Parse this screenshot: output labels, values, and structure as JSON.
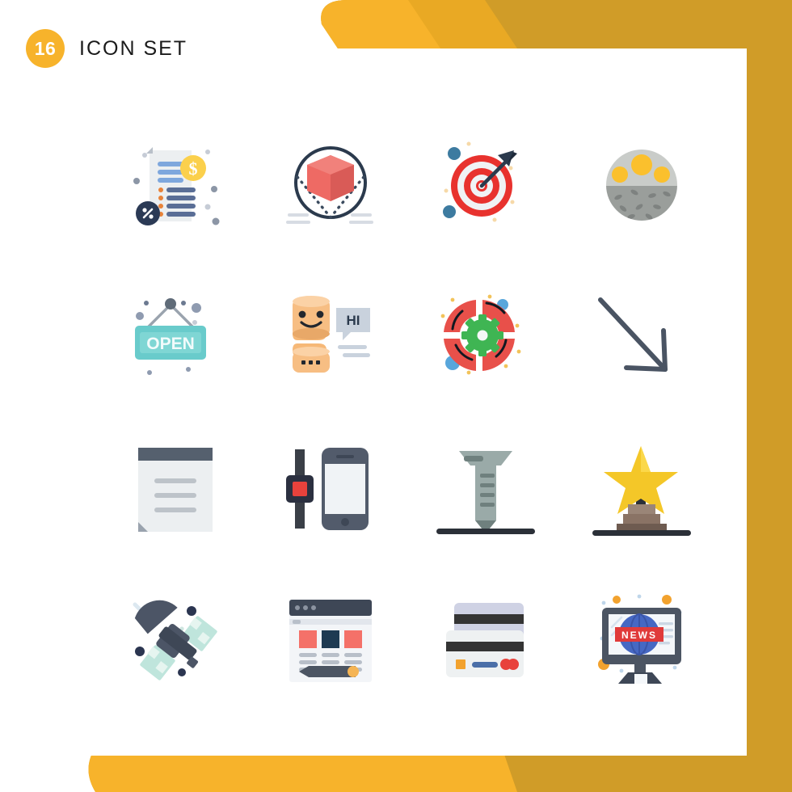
{
  "header": {
    "count": "16",
    "title": "Icon Set"
  },
  "theme": {
    "banner_light": "#F7B32B",
    "banner_mid": "#E9A924",
    "banner_dark": "#D09C28",
    "card_bg": "#FFFFFF",
    "title_color": "#1A1A1A",
    "badge_bg": "#F7B32B",
    "badge_text": "#FFFFFF"
  },
  "grid": {
    "columns": 4,
    "rows": 4,
    "icons": [
      {
        "id": 1,
        "name": "financial-document-icon",
        "label": "Financial document with dollar and percent badges"
      },
      {
        "id": 2,
        "name": "3d-cube-icon",
        "label": "3D cube in circle"
      },
      {
        "id": 3,
        "name": "target-arrow-icon",
        "label": "Target with arrow"
      },
      {
        "id": 4,
        "name": "frying-eggs-icon",
        "label": "Pan with fried eggs"
      },
      {
        "id": 5,
        "name": "open-sign-icon",
        "label": "Open hanging sign",
        "text": "OPEN"
      },
      {
        "id": 6,
        "name": "chatbot-icon",
        "label": "Chat robot with greeting bubble",
        "text": "HI"
      },
      {
        "id": 7,
        "name": "settings-target-icon",
        "label": "Crosshair with gear"
      },
      {
        "id": 8,
        "name": "diagonal-arrow-icon",
        "label": "Arrow pointing down right"
      },
      {
        "id": 9,
        "name": "document-note-icon",
        "label": "Note document with header bar"
      },
      {
        "id": 10,
        "name": "smartwatch-phone-icon",
        "label": "Smartwatch and smartphone"
      },
      {
        "id": 11,
        "name": "screw-icon",
        "label": "Screw into surface"
      },
      {
        "id": 12,
        "name": "star-trophy-icon",
        "label": "Star award on pedestal"
      },
      {
        "id": 13,
        "name": "satellite-icon",
        "label": "Satellite with dish"
      },
      {
        "id": 14,
        "name": "web-design-icon",
        "label": "Web page layout with pencil"
      },
      {
        "id": 15,
        "name": "credit-cards-icon",
        "label": "Stacked credit cards"
      },
      {
        "id": 16,
        "name": "news-monitor-icon",
        "label": "Monitor with globe news banner",
        "text": "NEWS"
      }
    ]
  }
}
